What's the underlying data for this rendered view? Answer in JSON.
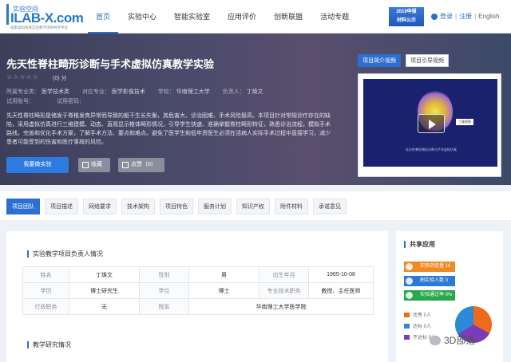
{
  "header": {
    "logo": {
      "cn": "实验空间",
      "en": "ILAB-X.com",
      "sub": "国家虚拟仿真实验教学项目共享平台"
    },
    "nav": [
      "首页",
      "实验中心",
      "智能实验室",
      "应用评价",
      "创新联盟",
      "活动专题"
    ],
    "nav_active": 0,
    "promo": {
      "line1": "2019申报",
      "line2": "材料公示"
    },
    "auth": {
      "login": "登录",
      "sep": "|",
      "register": "注册",
      "lang": "English"
    }
  },
  "hero": {
    "title": "先天性脊柱畸形诊断与手术虚拟仿真教学实验",
    "stars": "☆☆☆☆☆",
    "score": "(0) 分",
    "meta_row1": {
      "major_label": "所属专业类：",
      "major": "医学技术类",
      "course_label": "对应专业：",
      "course": "医学影像技术",
      "school_label": "学校：",
      "school": "华南理工大学",
      "leader_label": "负责人：",
      "leader": "丁焕文"
    },
    "meta_row2": {
      "users_label": "试用账号：",
      "pwd_label": "试用密码："
    },
    "description": "先天性脊柱畸形是储发于脊椎发育异常而导致的躯干生长失衡，其危害大、诊治困难、手术风险极高。本项目针对常规诊疗存在的缺陷，采用虚拟仿真进行三维建模、动态、直观显示椎体畸形情况，引导学生快速、准确掌握脊柱畸形特征，熟悉诊治流程，模拟手术路线，完善和优化手术方案，了解手术方法、要点和难点。避免了医学生和低年资医生必须在活病人实际手术过程中直接学习，减少患者可能受到的伤害和医疗事故的风险。",
    "buttons": {
      "do_experiment": "我要做实验",
      "favorite": "收藏",
      "like": "点赞（0）"
    },
    "video_tabs": [
      "项目简介视频",
      "项目引导视频"
    ],
    "video_tab_active": 0,
    "video": {
      "caption": "先天性脊柱畸形诊断与手术虚拟仿真",
      "corner": "三维视图"
    }
  },
  "tabs": [
    "项目团队",
    "项目描述",
    "网络要求",
    "技术架构",
    "项目特色",
    "服务计划",
    "知识产权",
    "附件材料",
    "承诺意见"
  ],
  "tab_active": 0,
  "main": {
    "section1": "实验教学项目负责人情况",
    "section2": "教学研究情况",
    "table": [
      [
        "姓名",
        "丁焕文",
        "性别",
        "男",
        "出生年月",
        "1965-10-08"
      ],
      [
        "学历",
        "博士研究生",
        "学位",
        "博士",
        "专业技术职务",
        "教授、主任医师"
      ],
      [
        "行政职务",
        "无",
        "院系",
        "华南理工大学医学院",
        "",
        ""
      ]
    ]
  },
  "share": {
    "title": "共享应用",
    "bars": [
      {
        "label": "实验浏览量 16",
        "color": "#f08a24"
      },
      {
        "label": "刷实验人数 0",
        "color": "#2b7ad8"
      },
      {
        "label": "实验通过率 0%",
        "color": "#28a84a"
      }
    ],
    "legend": [
      {
        "label": "优秀 0人",
        "color": "#f06a1e"
      },
      {
        "label": "达标 0人",
        "color": "#2b8ad8"
      },
      {
        "label": "不达标 0人",
        "color": "#7a3cb8"
      }
    ]
  },
  "watermark": "3D部落"
}
